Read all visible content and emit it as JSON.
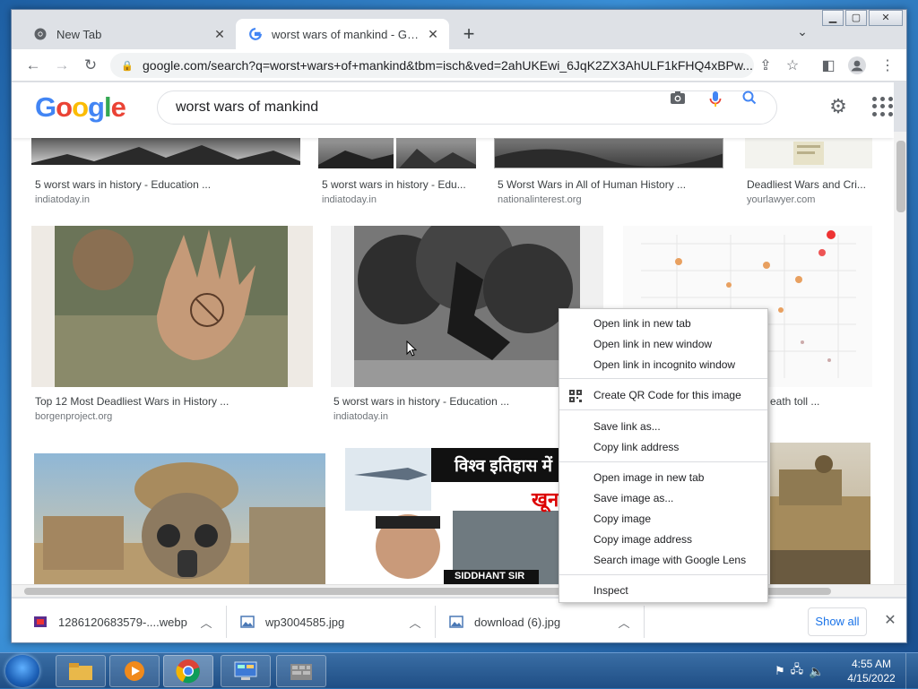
{
  "browser": {
    "tabs": [
      {
        "title": "New Tab"
      },
      {
        "title": "worst wars of mankind - Google Search"
      }
    ],
    "url": "google.com/search?q=worst+wars+of+mankind&tbm=isch&ved=2ahUKEwi_6JqK2ZX3AhULF1kFHQ4xBPw..."
  },
  "search": {
    "query": "worst wars of mankind",
    "logo_letters": [
      "G",
      "o",
      "o",
      "g",
      "l",
      "e"
    ]
  },
  "results": {
    "row1": [
      {
        "caption": "5 worst wars in history - Education ...",
        "source": "indiatoday.in"
      },
      {
        "caption": "5 worst wars in history - Edu...",
        "source": "indiatoday.in"
      },
      {
        "caption": "5 Worst Wars in All of Human History ...",
        "source": "nationalinterest.org"
      },
      {
        "caption": "Deadliest Wars and Cri...",
        "source": "yourlawyer.com"
      }
    ],
    "row2": [
      {
        "caption": "Top 12 Most Deadliest Wars in History ...",
        "source": "borgenproject.org"
      },
      {
        "caption": "5 worst wars in history - Education ...",
        "source": "indiatoday.in"
      },
      {
        "caption": "eath toll ...",
        "source": ""
      }
    ],
    "row3_overlay": {
      "hindi_title": "विश्व इतिहास में",
      "hindi_sub": "खून",
      "banner": "SIDDHANT SIR"
    }
  },
  "context_menu": {
    "groups": [
      [
        "Open link in new tab",
        "Open link in new window",
        "Open link in incognito window"
      ],
      [
        "Create QR Code for this image"
      ],
      [
        "Save link as...",
        "Copy link address"
      ],
      [
        "Open image in new tab",
        "Save image as...",
        "Copy image",
        "Copy image address",
        "Search image with Google Lens"
      ],
      [
        "Inspect"
      ]
    ]
  },
  "downloads": {
    "items": [
      {
        "name": "1286120683579-....webp"
      },
      {
        "name": "wp3004585.jpg"
      },
      {
        "name": "download (6).jpg"
      }
    ],
    "show_all": "Show all"
  },
  "taskbar": {
    "time": "4:55 AM",
    "date": "4/15/2022"
  },
  "colors": {
    "google_blue": "#4285f4",
    "google_red": "#ea4335",
    "google_yellow": "#fbbc05",
    "google_green": "#34a853",
    "link_blue": "#1a73e8"
  }
}
